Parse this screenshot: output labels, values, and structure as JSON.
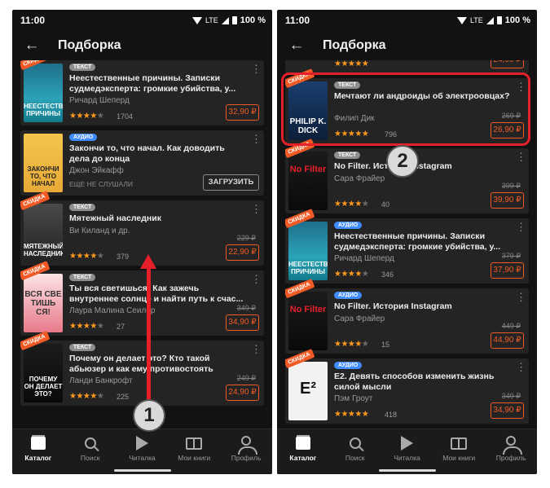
{
  "status": {
    "time": "11:00",
    "network": "LTE",
    "battery": "100 %"
  },
  "header": {
    "title": "Подборка"
  },
  "left_list": [
    {
      "badge": "ТЕКСТ",
      "badge_type": "text",
      "sale": "СКИДКА",
      "title": "Неестественные причины. Записки судмедэксперта: громкие убийства, у...",
      "author": "Ричард Шеперд",
      "stars": 4,
      "rating": "1704",
      "old_price": "",
      "price": "32,90 ₽",
      "cover": "teal",
      "cover_text": "НЕЕСТЕСТВЕННЫЕ ПРИЧИНЫ"
    },
    {
      "badge": "АУДИО",
      "badge_type": "audio",
      "sale": "",
      "title": "Закончи то, что начал. Как доводить дела до конца",
      "author": "Джон Эйкафф",
      "status": "ЕЩЕ НЕ СЛУШАЛИ",
      "action": "ЗАГРУЗИТЬ",
      "cover": "yellow",
      "cover_text": "ЗАКОНЧИ ТО, ЧТО НАЧАЛ"
    },
    {
      "badge": "ТЕКСТ",
      "badge_type": "text",
      "sale": "СКИДКА",
      "title": "Мятежный наследник",
      "author": "Ви Киланд и др.",
      "stars": 4,
      "rating": "379",
      "old_price": "229 ₽",
      "price": "22,90 ₽",
      "cover": "dark",
      "cover_text": "МЯТЕЖНЫЙ НАСЛЕДНИК"
    },
    {
      "badge": "ТЕКСТ",
      "badge_type": "text",
      "sale": "СКИДКА",
      "title": "Ты вся светишься! Как зажечь внутреннее солнце и найти путь к счас...",
      "author": "Лаура Малина Сеилер",
      "stars": 4,
      "rating": "27",
      "old_price": "349 ₽",
      "price": "34,90 ₽",
      "cover": "pink",
      "cover_text": "ВСЯ СВЕ ТИШЬ СЯ!"
    },
    {
      "badge": "ТЕКСТ",
      "badge_type": "text",
      "sale": "СКИДКА",
      "title": "Почему он делает это? Кто такой абьюзер и как ему противостоять",
      "author": "Ланди Банкрофт",
      "stars": 4,
      "rating": "225",
      "old_price": "249 ₽",
      "price": "24,90 ₽",
      "cover": "black",
      "cover_text": "ПОЧЕМУ ОН ДЕЛАЕТ ЭТО?"
    }
  ],
  "right_top_partial": {
    "stars": 5,
    "price": "24,90 ₽"
  },
  "right_list": [
    {
      "badge": "ТЕКСТ",
      "badge_type": "text",
      "sale": "СКИДКА",
      "title": "Мечтают ли андроиды об электроовцах?",
      "author": "Филип Дик",
      "stars": 5,
      "rating": "796",
      "old_price": "269 ₽",
      "price": "26,90 ₽",
      "cover": "navy",
      "cover_text": "PHILIP K. DICK"
    },
    {
      "badge": "ТЕКСТ",
      "badge_type": "text",
      "sale": "СКИДКА",
      "title": "No Filter. История Instagram",
      "author": "Сара Фрайер",
      "stars": 4,
      "rating": "40",
      "old_price": "399 ₽",
      "price": "39,90 ₽",
      "cover": "black",
      "cover_text": "No Filter"
    },
    {
      "badge": "АУДИО",
      "badge_type": "audio",
      "sale": "СКИДКА",
      "title": "Неестественные причины. Записки судмедэксперта: громкие убийства, у...",
      "author": "Ричард Шеперд",
      "stars": 4,
      "rating": "346",
      "old_price": "379 ₽",
      "price": "37,90 ₽",
      "cover": "teal",
      "cover_text": "НЕЕСТЕСТВЕННЫЕ ПРИЧИНЫ"
    },
    {
      "badge": "АУДИО",
      "badge_type": "audio",
      "sale": "СКИДКА",
      "title": "No Filter. История Instagram",
      "author": "Сара Фрайер",
      "stars": 4,
      "rating": "15",
      "old_price": "449 ₽",
      "price": "44,90 ₽",
      "cover": "black",
      "cover_text": "No Filter"
    },
    {
      "badge": "АУДИО",
      "badge_type": "audio",
      "sale": "СКИДКА",
      "title": "E2. Девять способов изменить жизнь силой мысли",
      "author": "Пэм Гроут",
      "stars": 5,
      "rating": "418",
      "old_price": "349 ₽",
      "price": "34,90 ₽",
      "cover": "white",
      "cover_text": "E²"
    }
  ],
  "nav": [
    {
      "label": "Каталог",
      "icon": "catalog-icon",
      "active": true
    },
    {
      "label": "Поиск",
      "icon": "search-icon"
    },
    {
      "label": "Читалка",
      "icon": "play-icon"
    },
    {
      "label": "Мои книги",
      "icon": "books-icon"
    },
    {
      "label": "Профиль",
      "icon": "profile-icon"
    }
  ],
  "annotations": {
    "marker1": "1",
    "marker2": "2",
    "highlight_color": "#e5202a",
    "accent": "#f15a24"
  }
}
